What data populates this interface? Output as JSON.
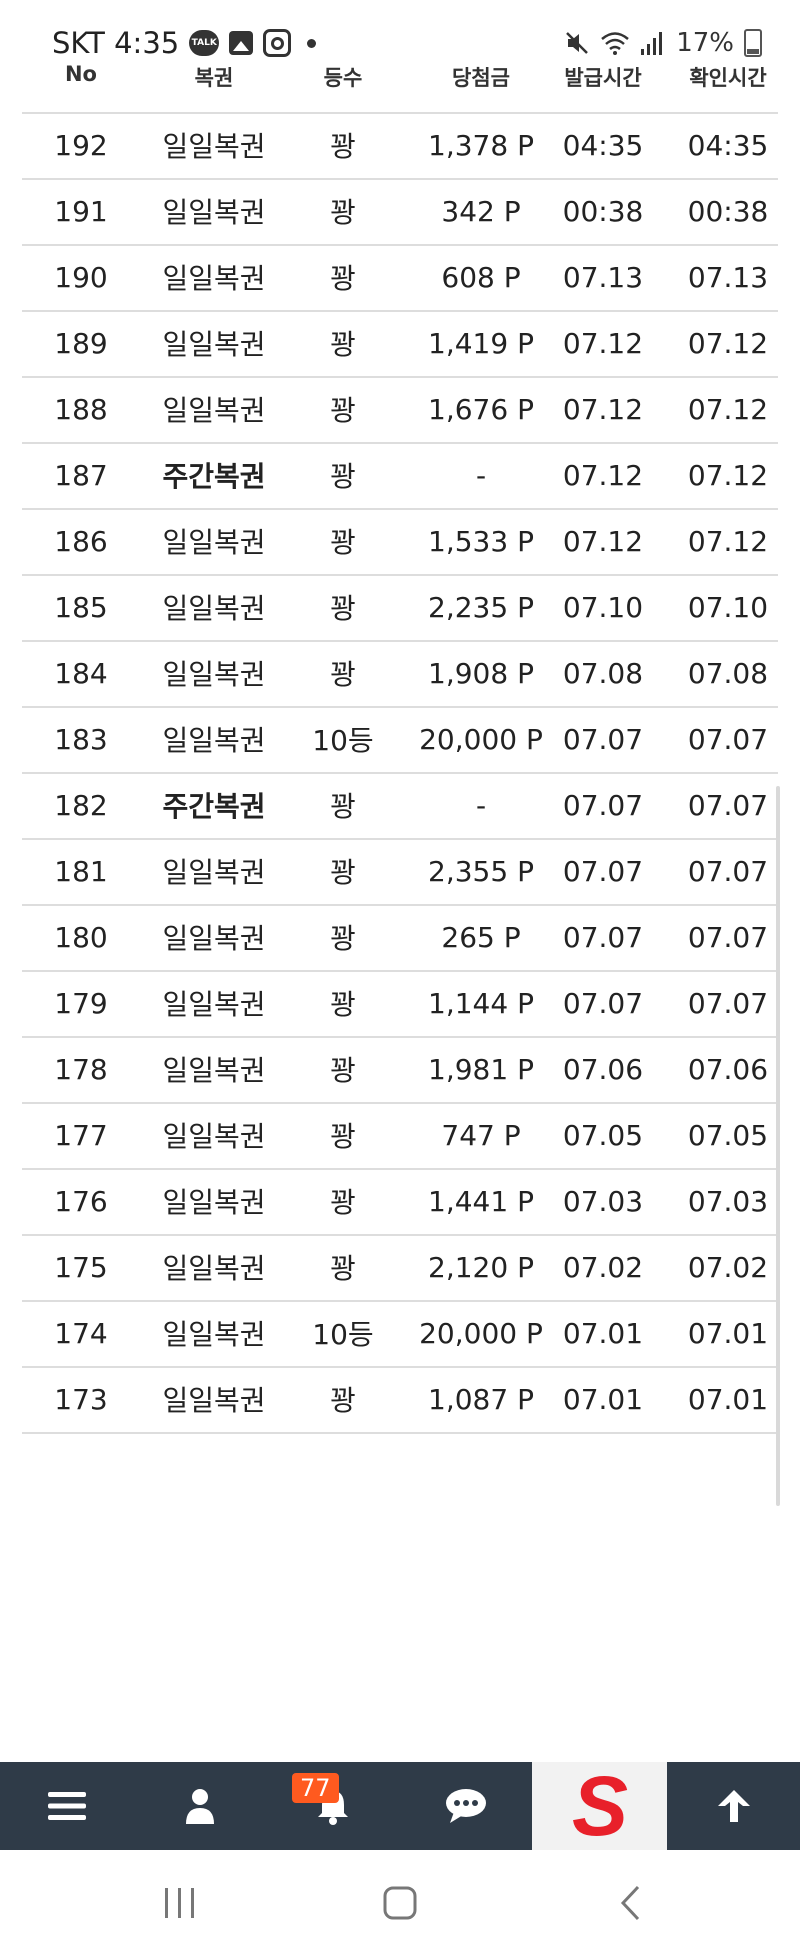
{
  "status_bar": {
    "carrier_time": "SKT 4:35",
    "talk_label": "TALK",
    "battery": "17%"
  },
  "table": {
    "headers": {
      "no": "No",
      "type": "복권",
      "rank": "등수",
      "prize": "당첨금",
      "issue_time": "발급시간",
      "check_time": "확인시간"
    },
    "rows": [
      {
        "no": "192",
        "type": "일일복권",
        "rank": "꽝",
        "prize": "1,378 P",
        "issue": "04:35",
        "check": "04:35"
      },
      {
        "no": "191",
        "type": "일일복권",
        "rank": "꽝",
        "prize": "342 P",
        "issue": "00:38",
        "check": "00:38"
      },
      {
        "no": "190",
        "type": "일일복권",
        "rank": "꽝",
        "prize": "608 P",
        "issue": "07.13",
        "check": "07.13"
      },
      {
        "no": "189",
        "type": "일일복권",
        "rank": "꽝",
        "prize": "1,419 P",
        "issue": "07.12",
        "check": "07.12"
      },
      {
        "no": "188",
        "type": "일일복권",
        "rank": "꽝",
        "prize": "1,676 P",
        "issue": "07.12",
        "check": "07.12"
      },
      {
        "no": "187",
        "type": "주간복권",
        "rank": "꽝",
        "prize": "-",
        "issue": "07.12",
        "check": "07.12",
        "weekly": true
      },
      {
        "no": "186",
        "type": "일일복권",
        "rank": "꽝",
        "prize": "1,533 P",
        "issue": "07.12",
        "check": "07.12"
      },
      {
        "no": "185",
        "type": "일일복권",
        "rank": "꽝",
        "prize": "2,235 P",
        "issue": "07.10",
        "check": "07.10"
      },
      {
        "no": "184",
        "type": "일일복권",
        "rank": "꽝",
        "prize": "1,908 P",
        "issue": "07.08",
        "check": "07.08"
      },
      {
        "no": "183",
        "type": "일일복권",
        "rank": "10등",
        "prize": "20,000 P",
        "issue": "07.07",
        "check": "07.07"
      },
      {
        "no": "182",
        "type": "주간복권",
        "rank": "꽝",
        "prize": "-",
        "issue": "07.07",
        "check": "07.07",
        "weekly": true
      },
      {
        "no": "181",
        "type": "일일복권",
        "rank": "꽝",
        "prize": "2,355 P",
        "issue": "07.07",
        "check": "07.07"
      },
      {
        "no": "180",
        "type": "일일복권",
        "rank": "꽝",
        "prize": "265 P",
        "issue": "07.07",
        "check": "07.07"
      },
      {
        "no": "179",
        "type": "일일복권",
        "rank": "꽝",
        "prize": "1,144 P",
        "issue": "07.07",
        "check": "07.07"
      },
      {
        "no": "178",
        "type": "일일복권",
        "rank": "꽝",
        "prize": "1,981 P",
        "issue": "07.06",
        "check": "07.06"
      },
      {
        "no": "177",
        "type": "일일복권",
        "rank": "꽝",
        "prize": "747 P",
        "issue": "07.05",
        "check": "07.05"
      },
      {
        "no": "176",
        "type": "일일복권",
        "rank": "꽝",
        "prize": "1,441 P",
        "issue": "07.03",
        "check": "07.03"
      },
      {
        "no": "175",
        "type": "일일복권",
        "rank": "꽝",
        "prize": "2,120 P",
        "issue": "07.02",
        "check": "07.02"
      },
      {
        "no": "174",
        "type": "일일복권",
        "rank": "10등",
        "prize": "20,000 P",
        "issue": "07.01",
        "check": "07.01"
      },
      {
        "no": "173",
        "type": "일일복권",
        "rank": "꽝",
        "prize": "1,087 P",
        "issue": "07.01",
        "check": "07.01"
      }
    ]
  },
  "toolbar": {
    "notification_count": "77",
    "items": [
      "menu-icon",
      "user-icon",
      "bell-icon",
      "chat-icon",
      "s-logo",
      "arrow-up-icon"
    ],
    "logo_letter": "S",
    "colors": {
      "background": "#2f3b48",
      "badge": "#ff5a1f",
      "logo": "#e8202a"
    }
  },
  "nav_bar": {
    "items": [
      "recent-apps-icon",
      "home-icon",
      "back-icon"
    ]
  }
}
